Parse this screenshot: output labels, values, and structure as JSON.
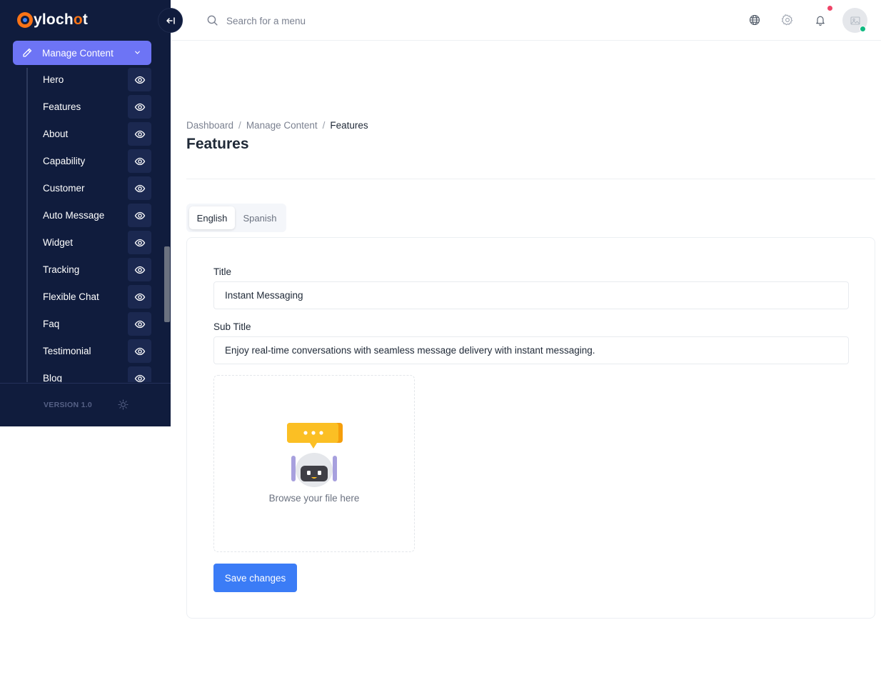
{
  "brand": {
    "name_prefix": "ylo",
    "name_mid": "ch",
    "name_o": "o",
    "name_suffix": "t",
    "accent": "#f97316"
  },
  "sidebar": {
    "manage_label": "Manage Content",
    "items": [
      {
        "label": "Hero"
      },
      {
        "label": "Features"
      },
      {
        "label": "About"
      },
      {
        "label": "Capability"
      },
      {
        "label": "Customer"
      },
      {
        "label": "Auto Message"
      },
      {
        "label": "Widget"
      },
      {
        "label": "Tracking"
      },
      {
        "label": "Flexible Chat"
      },
      {
        "label": "Faq"
      },
      {
        "label": "Testimonial"
      },
      {
        "label": "Blog"
      }
    ],
    "version": "VERSION 1.0"
  },
  "header": {
    "search_placeholder": "Search for a menu"
  },
  "breadcrumb": {
    "items": [
      "Dashboard",
      "Manage Content"
    ],
    "current": "Features"
  },
  "page": {
    "title": "Features"
  },
  "tabs": [
    {
      "label": "English",
      "active": true
    },
    {
      "label": "Spanish",
      "active": false
    }
  ],
  "form": {
    "title_label": "Title",
    "title_value": "Instant Messaging",
    "subtitle_label": "Sub Title",
    "subtitle_value": "Enjoy real-time conversations with seamless message delivery with instant messaging.",
    "upload_text": "Browse your file here",
    "save_label": "Save changes"
  },
  "colors": {
    "sidebar_bg": "#101c3d",
    "manage_active": "#6d74f5",
    "primary": "#3b7cf6",
    "notification": "#ef4467",
    "online": "#10b981"
  }
}
